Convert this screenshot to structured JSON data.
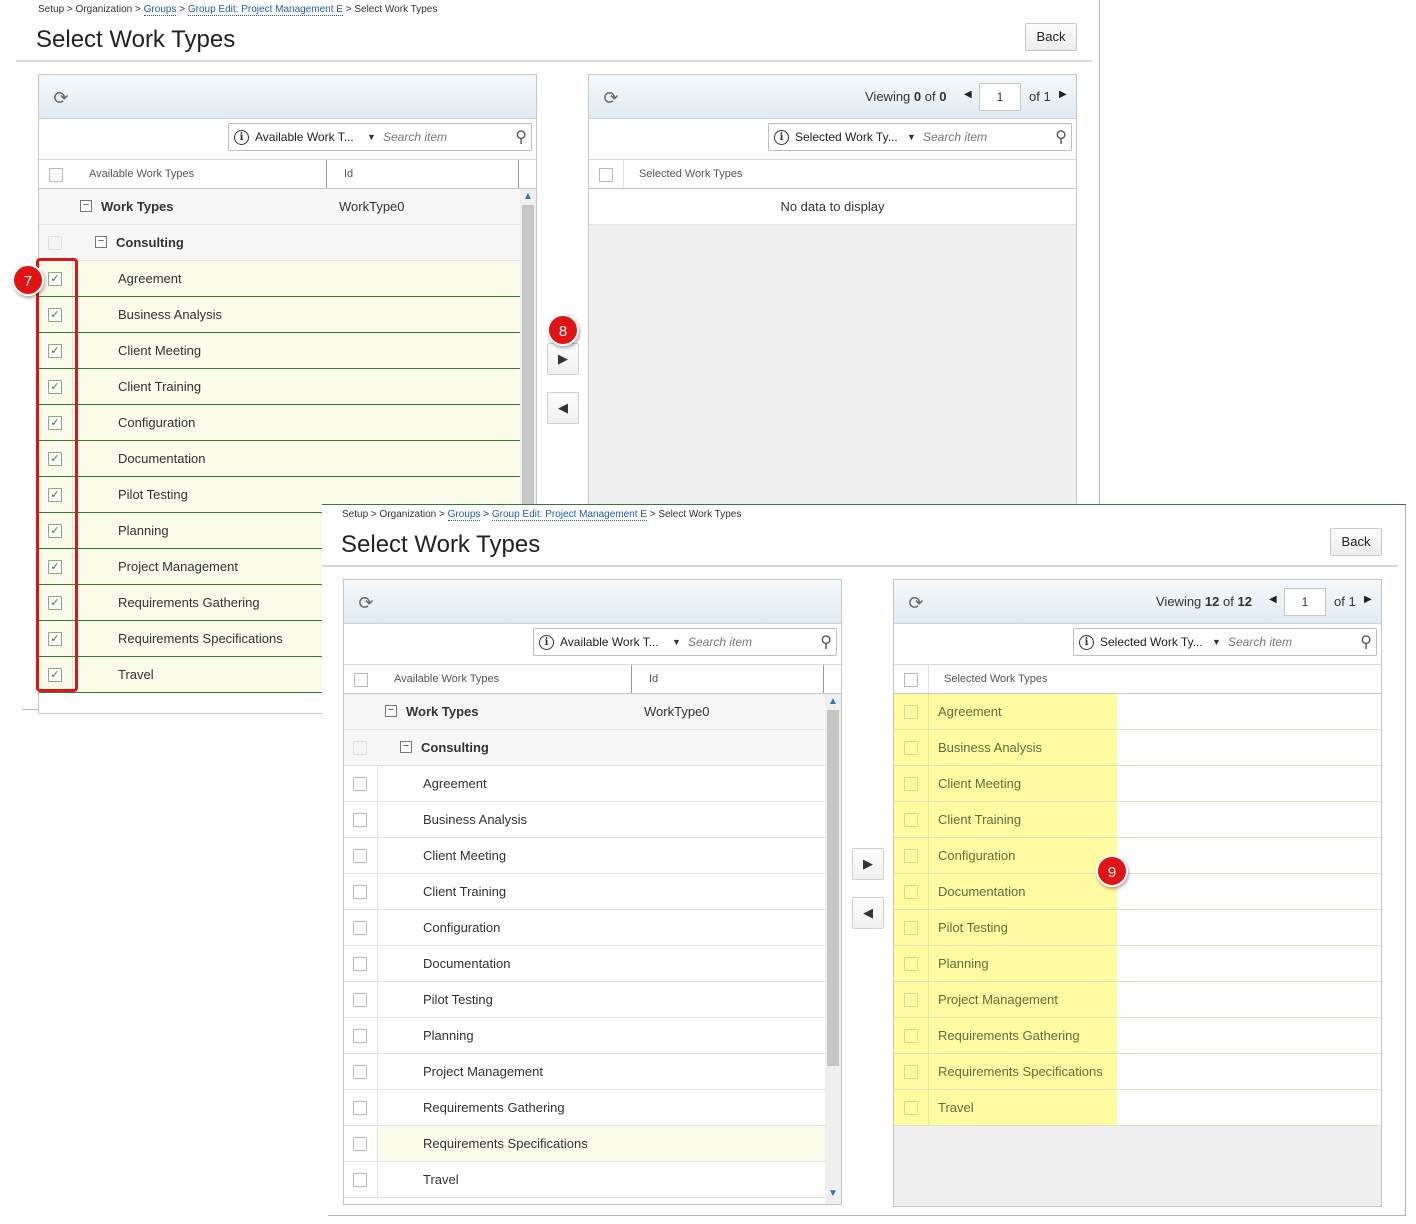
{
  "breadcrumb": {
    "setup": "Setup",
    "sep": ">",
    "organization": "Organization",
    "groups": "Groups",
    "group_edit": "Group Edit: Project Management E",
    "current": "Select Work Types"
  },
  "page_title": "Select Work Types",
  "back_label": "Back",
  "available_panel": {
    "search_scope": "Available Work T...",
    "search_placeholder": "Search item",
    "col_name": "Available Work Types",
    "col_id": "Id",
    "root": {
      "label": "Work Types",
      "id": "WorkType0"
    },
    "group": {
      "label": "Consulting"
    },
    "items": [
      "Agreement",
      "Business Analysis",
      "Client Meeting",
      "Client Training",
      "Configuration",
      "Documentation",
      "Pilot Testing",
      "Planning",
      "Project Management",
      "Requirements Gathering",
      "Requirements Specifications",
      "Travel"
    ]
  },
  "selected_panel_before": {
    "viewing_label": "Viewing",
    "viewing_count": "0",
    "viewing_of": "of",
    "viewing_total": "0",
    "page": "1",
    "page_of": "of 1",
    "search_scope": "Selected Work Ty...",
    "search_placeholder": "Search item",
    "col_name": "Selected Work Types",
    "empty_text": "No data to display"
  },
  "selected_panel_after": {
    "viewing_label": "Viewing",
    "viewing_count": "12",
    "viewing_of": "of",
    "viewing_total": "12",
    "page": "1",
    "page_of": "of 1",
    "search_scope": "Selected Work Ty...",
    "search_placeholder": "Search item",
    "col_name": "Selected Work Types",
    "items": [
      "Agreement",
      "Business Analysis",
      "Client Meeting",
      "Client Training",
      "Configuration",
      "Documentation",
      "Pilot Testing",
      "Planning",
      "Project Management",
      "Requirements Gathering",
      "Requirements Specifications",
      "Travel"
    ]
  },
  "callouts": {
    "step7": "7",
    "step8": "8",
    "step9": "9"
  },
  "icons": {
    "refresh": "refresh-icon",
    "info": "info-icon",
    "search": "search-icon",
    "move_right": "move-right-icon",
    "move_left": "move-left-icon",
    "collapse": "collapse-icon",
    "check": "check-icon"
  },
  "colors": {
    "accent_red": "#e01414",
    "highlight_yellow": "#fefb9c",
    "selected_row": "#fafbe8",
    "link_blue": "#1a5fb4"
  }
}
